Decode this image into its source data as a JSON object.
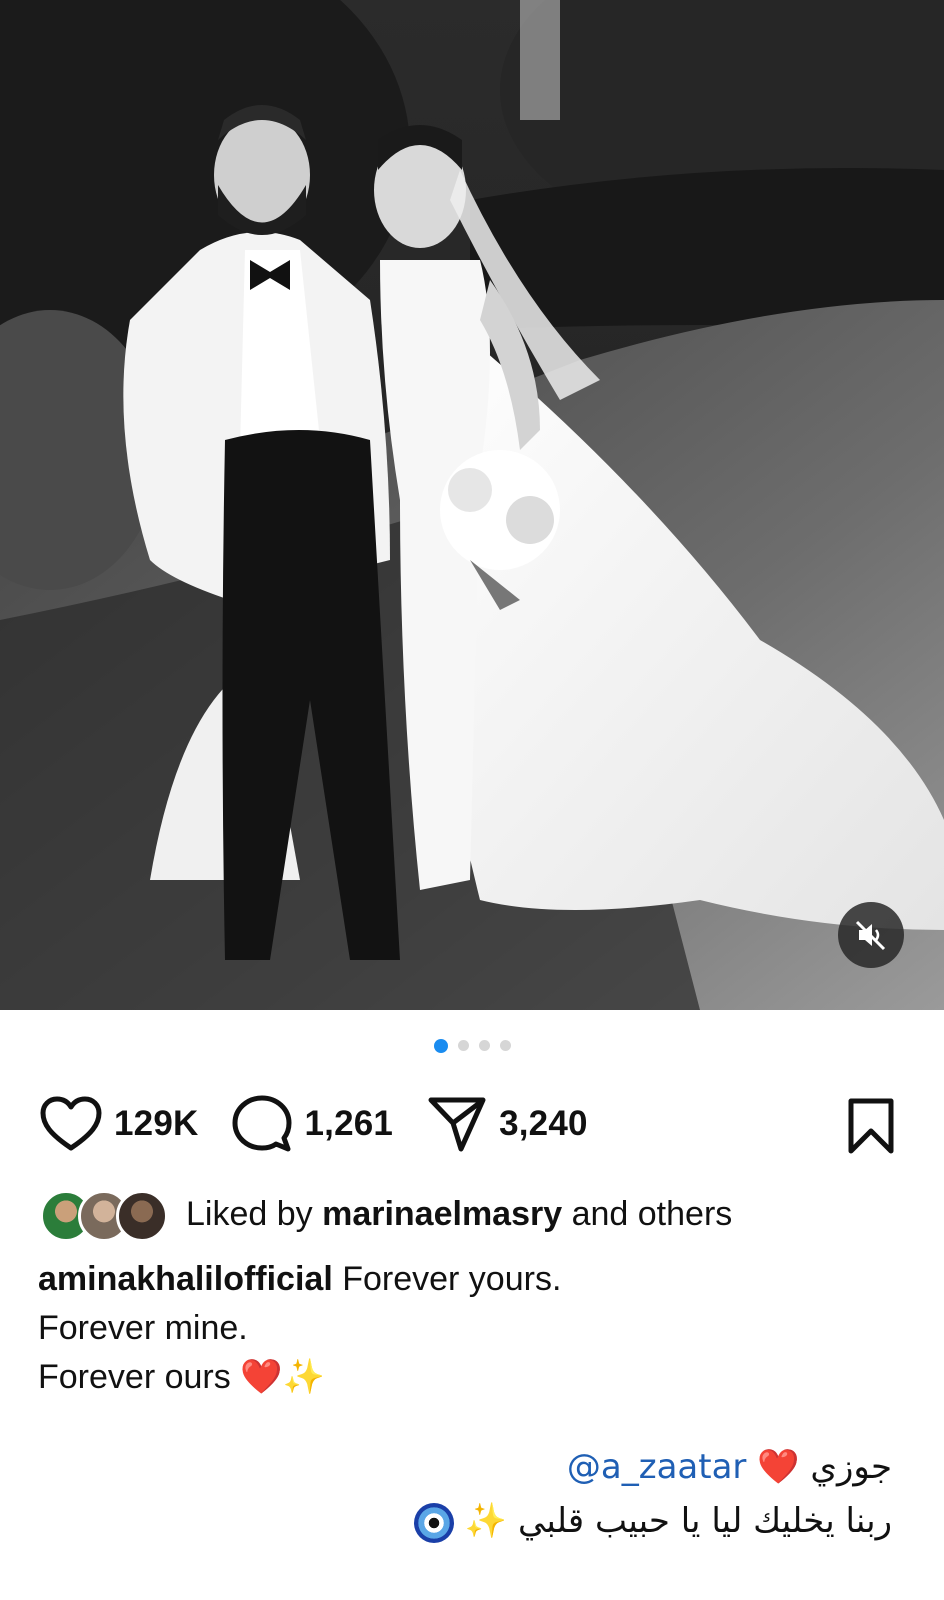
{
  "post": {
    "media": {
      "description_icon": "photo",
      "mute_icon": "speaker-muted-icon",
      "carousel_count": 4,
      "carousel_active_index": 0
    },
    "actions": {
      "likes_count": "129K",
      "comments_count": "1,261",
      "shares_count": "3,240"
    },
    "liked_by": {
      "prefix": "Liked by",
      "user": "marinaelmasry",
      "suffix": "and others"
    },
    "caption": {
      "author": "aminakhalilofficial",
      "line1": "Forever yours.",
      "line2": "Forever mine.",
      "line3": "Forever ours",
      "heart_emoji": "❤️",
      "sparkle_emoji": "✨"
    },
    "comment": {
      "arabic_word": "جوزي",
      "heart_emoji": "❤️",
      "mention": "@a_zaatar",
      "line2": "ربنا يخليك ليا يا حبيب قلبي",
      "sparkle_emoji": "✨"
    }
  },
  "colors": {
    "accent": "#1a8cf0",
    "mention": "#1f5fb4",
    "heart": "#e0242e"
  }
}
